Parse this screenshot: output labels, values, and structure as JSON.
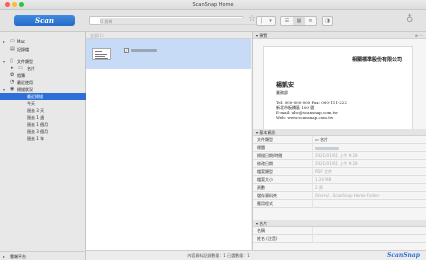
{
  "window": {
    "title": "ScanSnap Home"
  },
  "toolbar": {
    "scan_label": "Scan",
    "search_placeholder": "Q  搜尋"
  },
  "sidebar": {
    "items": [
      {
        "label": "Mac",
        "icon": "computer-icon"
      },
      {
        "label": "記錄檔",
        "icon": "log-icon"
      },
      {
        "label": "文件類型",
        "icon": "document-icon"
      },
      {
        "label": "名片",
        "icon": "card-icon"
      },
      {
        "label": "相簿",
        "icon": "photo-icon"
      },
      {
        "label": "最近使用",
        "icon": "clock-icon"
      },
      {
        "label": "掃描狀況",
        "icon": "scan-status-icon"
      },
      {
        "label": "最近掃描"
      },
      {
        "label": "今天"
      },
      {
        "label": "過去 3 天"
      },
      {
        "label": "過去 1 週"
      },
      {
        "label": "過去 1 個月"
      },
      {
        "label": "過去 3 個月"
      },
      {
        "label": "過去 1 年"
      }
    ],
    "footer_label": "雲端平台"
  },
  "main": {
    "header_text": "全部(1)",
    "status_text": "內容資料記錄數量：1  已選數量：1"
  },
  "right": {
    "preview_header": "預覽",
    "card": {
      "company": "相關標準股份有限公司",
      "name": "楊凱安",
      "role": "業務部",
      "lines": [
        "Tel: 000-000-000  Fax: 000-111-222",
        "新北市板橋區 100 號",
        "E-mail: abc@scansnap.com.tw",
        "Web: www.scansnap.com.tw"
      ]
    },
    "info_header": "基本資訊",
    "fields": [
      {
        "k": "文件類型",
        "v": "名片"
      },
      {
        "k": "標題",
        "v": ""
      },
      {
        "k": "掃描日期/時間",
        "v": "2021/01/01 上午 9:28"
      },
      {
        "k": "修改日期",
        "v": "2021/01/01 上午 9:28"
      },
      {
        "k": "檔案類型",
        "v": "PDF 文件"
      },
      {
        "k": "檔案大小",
        "v": "1.24 MB"
      },
      {
        "k": "頁數",
        "v": "2 頁"
      },
      {
        "k": "儲存資料夾",
        "v": "/Users/...ScanSnap Home Folder"
      },
      {
        "k": "應用程式",
        "v": ""
      }
    ],
    "contact_header": "名片",
    "contact_fields": [
      {
        "k": "名稱",
        "v": ""
      },
      {
        "k": "姓名 (注音)",
        "v": ""
      }
    ]
  },
  "footer_brand": "ScanSnap",
  "colors": {
    "accent": "#2d6fd6",
    "selection": "#c7dbf6"
  }
}
